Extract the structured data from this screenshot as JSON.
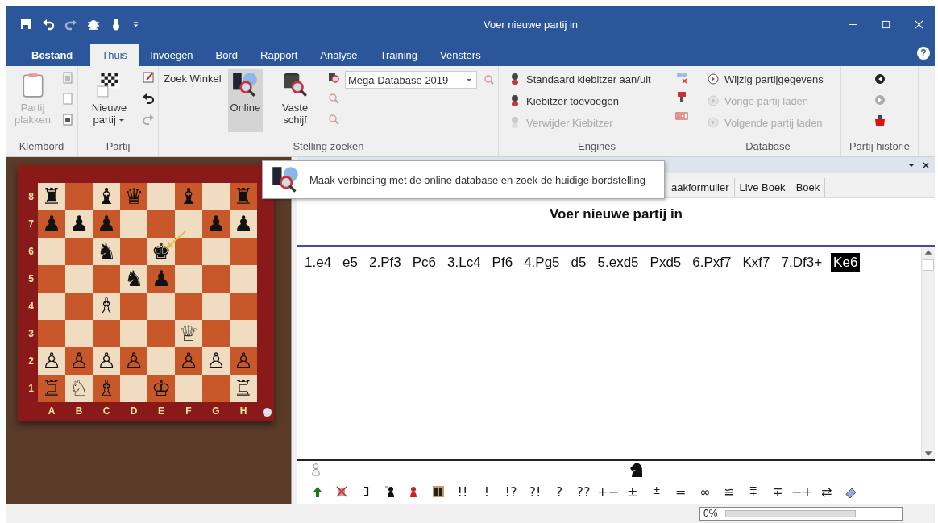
{
  "window": {
    "title": "Voer nieuwe partij in",
    "help": "?"
  },
  "ribbon_tabs": [
    {
      "label": "Bestand",
      "selected": false,
      "kind": "file"
    },
    {
      "label": "Thuis",
      "selected": true,
      "kind": "tab"
    },
    {
      "label": "Invoegen",
      "selected": false,
      "kind": "tab"
    },
    {
      "label": "Bord",
      "selected": false,
      "kind": "tab"
    },
    {
      "label": "Rapport",
      "selected": false,
      "kind": "tab"
    },
    {
      "label": "Analyse",
      "selected": false,
      "kind": "tab"
    },
    {
      "label": "Training",
      "selected": false,
      "kind": "tab"
    },
    {
      "label": "Vensters",
      "selected": false,
      "kind": "tab"
    }
  ],
  "ribbon": {
    "clipboard": {
      "label": "Klembord",
      "paste": {
        "label": "Partij plakken",
        "disabled": true
      }
    },
    "game": {
      "label": "Partij",
      "new_game": {
        "label": "Nieuwe partij"
      }
    },
    "position_search": {
      "label": "Stelling zoeken",
      "shop_search": "Zoek Winkel",
      "online": {
        "label": "Online",
        "selected": true
      },
      "hard_disk": {
        "label": "Vaste schijf",
        "selected": false
      },
      "database_select": {
        "value": "Mega Database 2019"
      }
    },
    "engines": {
      "label": "Engines",
      "items": [
        {
          "label": "Standaard kiebitzer aan/uit",
          "disabled": false
        },
        {
          "label": "Kiebitzer toevoegen",
          "disabled": false
        },
        {
          "label": "Verwijder Kiebitzer",
          "disabled": true
        }
      ]
    },
    "database": {
      "label": "Database",
      "items": [
        {
          "label": "Wijzig partijgegevens",
          "disabled": false
        },
        {
          "label": "Vorige partij laden",
          "disabled": true
        },
        {
          "label": "Volgende partij laden",
          "disabled": true
        }
      ]
    },
    "game_history": {
      "label": "Partij historie"
    }
  },
  "tooltip": {
    "text": "Maak verbinding met de online database en zoek de huidige bordstelling"
  },
  "board": {
    "ranks": [
      {
        "label": "8",
        "squares": [
          {
            "kind": "piece",
            "piece": "♜"
          },
          {
            "kind": "empty"
          },
          {
            "kind": "piece",
            "piece": "♝"
          },
          {
            "kind": "piece",
            "piece": "♛"
          },
          {
            "kind": "empty"
          },
          {
            "kind": "piece",
            "piece": "♝"
          },
          {
            "kind": "empty"
          },
          {
            "kind": "piece",
            "piece": "♜"
          }
        ]
      },
      {
        "label": "7",
        "squares": [
          {
            "kind": "piece",
            "piece": "♟"
          },
          {
            "kind": "piece",
            "piece": "♟"
          },
          {
            "kind": "piece",
            "piece": "♟"
          },
          {
            "kind": "empty"
          },
          {
            "kind": "empty"
          },
          {
            "kind": "empty"
          },
          {
            "kind": "piece",
            "piece": "♟"
          },
          {
            "kind": "piece",
            "piece": "♟"
          }
        ]
      },
      {
        "label": "6",
        "squares": [
          {
            "kind": "empty"
          },
          {
            "kind": "empty"
          },
          {
            "kind": "piece",
            "piece": "♞"
          },
          {
            "kind": "empty"
          },
          {
            "kind": "piece",
            "piece": "♚"
          },
          {
            "kind": "empty"
          },
          {
            "kind": "empty"
          },
          {
            "kind": "empty"
          }
        ]
      },
      {
        "label": "5",
        "squares": [
          {
            "kind": "empty"
          },
          {
            "kind": "empty"
          },
          {
            "kind": "empty"
          },
          {
            "kind": "piece",
            "piece": "♞"
          },
          {
            "kind": "piece",
            "piece": "♟"
          },
          {
            "kind": "empty"
          },
          {
            "kind": "empty"
          },
          {
            "kind": "empty"
          }
        ]
      },
      {
        "label": "4",
        "squares": [
          {
            "kind": "empty"
          },
          {
            "kind": "empty"
          },
          {
            "kind": "piece",
            "piece": "♗"
          },
          {
            "kind": "empty"
          },
          {
            "kind": "empty"
          },
          {
            "kind": "empty"
          },
          {
            "kind": "empty"
          },
          {
            "kind": "empty"
          }
        ]
      },
      {
        "label": "3",
        "squares": [
          {
            "kind": "empty"
          },
          {
            "kind": "empty"
          },
          {
            "kind": "empty"
          },
          {
            "kind": "empty"
          },
          {
            "kind": "empty"
          },
          {
            "kind": "piece",
            "piece": "♕"
          },
          {
            "kind": "empty"
          },
          {
            "kind": "empty"
          }
        ]
      },
      {
        "label": "2",
        "squares": [
          {
            "kind": "piece",
            "piece": "♙"
          },
          {
            "kind": "piece",
            "piece": "♙"
          },
          {
            "kind": "piece",
            "piece": "♙"
          },
          {
            "kind": "piece",
            "piece": "♙"
          },
          {
            "kind": "empty"
          },
          {
            "kind": "piece",
            "piece": "♙"
          },
          {
            "kind": "piece",
            "piece": "♙"
          },
          {
            "kind": "piece",
            "piece": "♙"
          }
        ]
      },
      {
        "label": "1",
        "squares": [
          {
            "kind": "piece",
            "piece": "♖"
          },
          {
            "kind": "piece",
            "piece": "♘"
          },
          {
            "kind": "piece",
            "piece": "♗"
          },
          {
            "kind": "empty"
          },
          {
            "kind": "piece",
            "piece": "♔"
          },
          {
            "kind": "empty"
          },
          {
            "kind": "empty"
          },
          {
            "kind": "piece",
            "piece": "♖"
          }
        ]
      }
    ],
    "files": [
      "A",
      "B",
      "C",
      "D",
      "E",
      "F",
      "G",
      "H"
    ]
  },
  "notation_panel": {
    "tabs": [
      {
        "label": "aakformulier"
      },
      {
        "label": "Live Boek"
      },
      {
        "label": "Boek"
      }
    ],
    "title": "Voer nieuwe partij in",
    "moves": [
      {
        "text": "1.e4",
        "selected": false
      },
      {
        "text": "e5",
        "selected": false
      },
      {
        "text": "2.Pf3",
        "selected": false
      },
      {
        "text": "Pc6",
        "selected": false
      },
      {
        "text": "3.Lc4",
        "selected": false
      },
      {
        "text": "Pf6",
        "selected": false
      },
      {
        "text": "4.Pg5",
        "selected": false
      },
      {
        "text": "d5",
        "selected": false
      },
      {
        "text": "5.exd5",
        "selected": false
      },
      {
        "text": "Pxd5",
        "selected": false
      },
      {
        "text": "6.Pxf7",
        "selected": false
      },
      {
        "text": "Kxf7",
        "selected": false
      },
      {
        "text": "7.Df3+",
        "selected": false
      },
      {
        "text": "Ke6",
        "selected": true
      }
    ],
    "annotation_symbols": [
      "!!",
      "!",
      "!?",
      "?!",
      "?",
      "??",
      "+−",
      "±",
      "⩲",
      "=",
      "∞",
      "≌",
      "⩱",
      "∓",
      "−+",
      "⇄"
    ]
  },
  "status_bar": {
    "progress": {
      "text": "0%",
      "level": 0
    }
  }
}
